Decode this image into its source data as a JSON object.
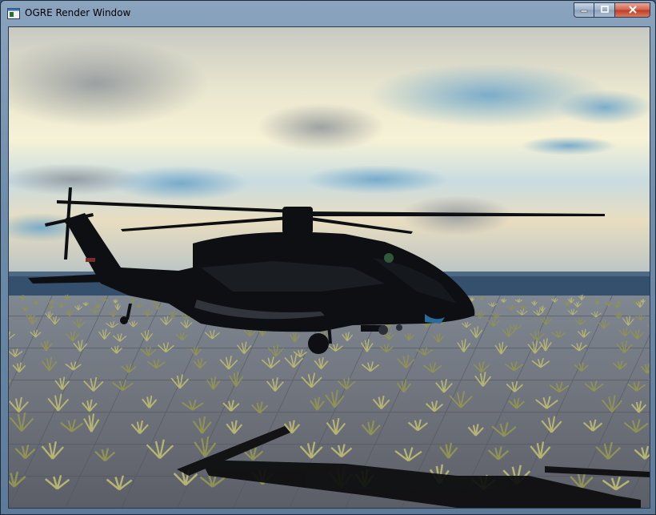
{
  "window": {
    "title": "OGRE Render Window",
    "icons": {
      "app": "app-window-icon",
      "minimize": "minimize-icon",
      "maximize": "maximize-icon",
      "close": "close-icon"
    }
  },
  "viewport": {
    "scene": "helicopter-over-grass-field",
    "colors": {
      "sky_top": "#8fb3cc",
      "sky_glow": "#f4efcf",
      "sea": "#2f4b68",
      "ground": "#6e7480",
      "grass": "#a8a766",
      "helicopter": "#0d0f12"
    }
  }
}
